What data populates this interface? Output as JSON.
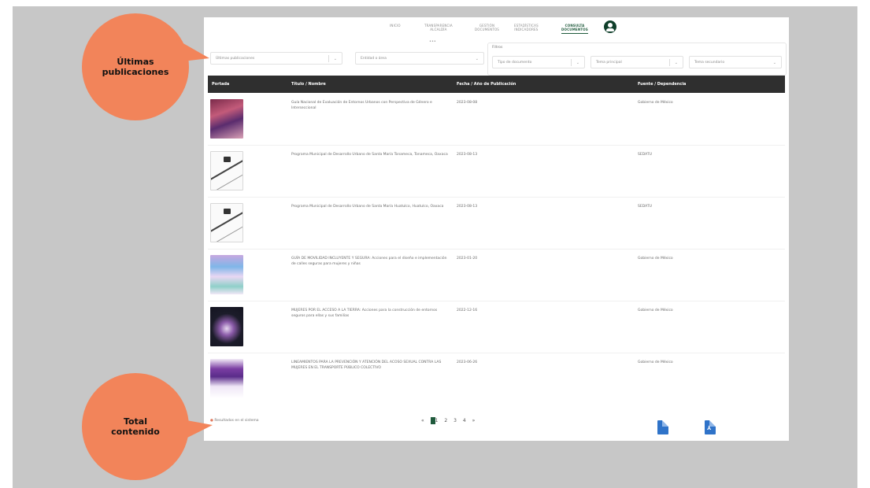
{
  "nav": {
    "items": [
      {
        "label": "INICIO"
      },
      {
        "label": "TRANSPARENCIA\nALCALDÍA"
      },
      {
        "label": "GESTIÓN\nDOCUMENTOS"
      },
      {
        "label": "ESTADÍSTICAS\nINDICADORES"
      },
      {
        "label": "CONSULTA\nDOCUMENTOS"
      }
    ],
    "dot": "•••"
  },
  "filters": {
    "main_select": "Últimas publicaciones",
    "second_select": "Entidad o área",
    "box_label": "Filtros",
    "filter1": "Tipo de documento",
    "filter2": "Tema principal",
    "filter3": "Tema secundario"
  },
  "table": {
    "headers": [
      "Portada",
      "Título / Nombre",
      "Fecha / Año de Publicación",
      "Fuente / Dependencia"
    ],
    "rows": [
      {
        "title": "Guía Nacional de Evaluación de Entornos Urbanos con Perspectiva de Género e Interseccional",
        "date": "2023-08-08",
        "source": "Gobierno de México"
      },
      {
        "title": "Programa Municipal de Desarrollo Urbano de Santa María Tonameca, Tonameca, Oaxaca",
        "date": "2023-08-13",
        "source": "SEDATU"
      },
      {
        "title": "Programa Municipal de Desarrollo Urbano de Santa María Huatulco, Huatulco, Oaxaca",
        "date": "2023-08-13",
        "source": "SEDATU"
      },
      {
        "title": "GUÍA DE MOVILIDAD INCLUYENTE Y SEGURA: Acciones para el diseño e implementación de calles seguras para mujeres y niñas",
        "date": "2023-01-20",
        "source": "Gobierno de México"
      },
      {
        "title": "MUJERES POR EL ACCESO A LA TIERRA: Acciones para la construcción de entornos seguros para ellas y sus familias",
        "date": "2022-12-16",
        "source": "Gobierno de México"
      },
      {
        "title": "LINEAMIENTOS PARA LA PREVENCIÓN Y ATENCIÓN DEL ACOSO SEXUAL CONTRA LAS MUJERES EN EL TRANSPORTE PÚBLICO COLECTIVO",
        "date": "2023-06-26",
        "source": "Gobierno de México"
      }
    ]
  },
  "footer": {
    "total_text": "Resultados en el sistema",
    "pager": [
      "«",
      "1",
      "2",
      "3",
      "4",
      "»"
    ]
  },
  "callouts": {
    "top": "Últimas\npublicaciones",
    "bottom": "Total\ncontenido"
  },
  "colors": {
    "callout": "#f2845a",
    "header_bar": "#2f2f2f",
    "accent_green": "#1f5a3c",
    "file_blue": "#2f73c9"
  },
  "icons": {
    "user": "user-circle-icon",
    "export_doc": "document-icon",
    "export_pdf": "pdf-icon"
  }
}
